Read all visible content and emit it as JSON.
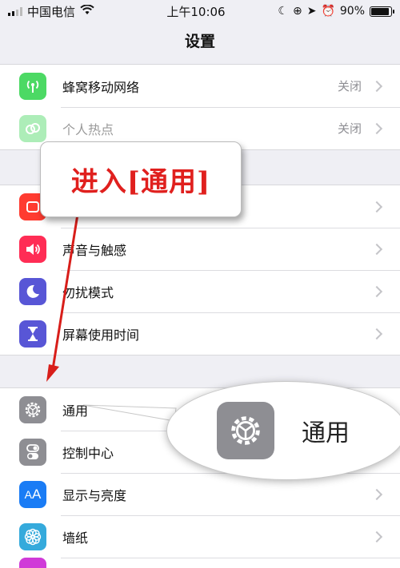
{
  "status_bar": {
    "carrier": "中国电信",
    "time": "上午10:06",
    "battery": "90%",
    "battery_level": 0.9
  },
  "nav": {
    "title": "设置"
  },
  "groups": [
    {
      "rows": [
        {
          "label": "蜂窝移动网络",
          "value": "关闭",
          "icon": "antenna-icon"
        },
        {
          "label": "个人热点",
          "value": "关闭",
          "icon": "hotspot-link-icon"
        }
      ]
    },
    {
      "rows": [
        {
          "label": "",
          "value": "",
          "icon": "notification-icon"
        },
        {
          "label": "声音与触感",
          "value": "",
          "icon": "speaker-icon"
        },
        {
          "label": "勿扰模式",
          "value": "",
          "icon": "moon-icon"
        },
        {
          "label": "屏幕使用时间",
          "value": "",
          "icon": "hourglass-icon"
        }
      ]
    },
    {
      "rows": [
        {
          "label": "通用",
          "value": "",
          "icon": "gear-icon"
        },
        {
          "label": "控制中心",
          "value": "",
          "icon": "toggles-icon"
        },
        {
          "label": "显示与亮度",
          "value": "",
          "icon": "text-size-icon"
        },
        {
          "label": "墙纸",
          "value": "",
          "icon": "flower-icon"
        }
      ]
    }
  ],
  "callout": {
    "text": "进入[通用]"
  },
  "zoom": {
    "label": "通用",
    "icon": "gear-icon"
  },
  "colors": {
    "callout_text": "#e0201e",
    "arrow": "#d81e1a",
    "general_icon": "#8e8e93"
  }
}
